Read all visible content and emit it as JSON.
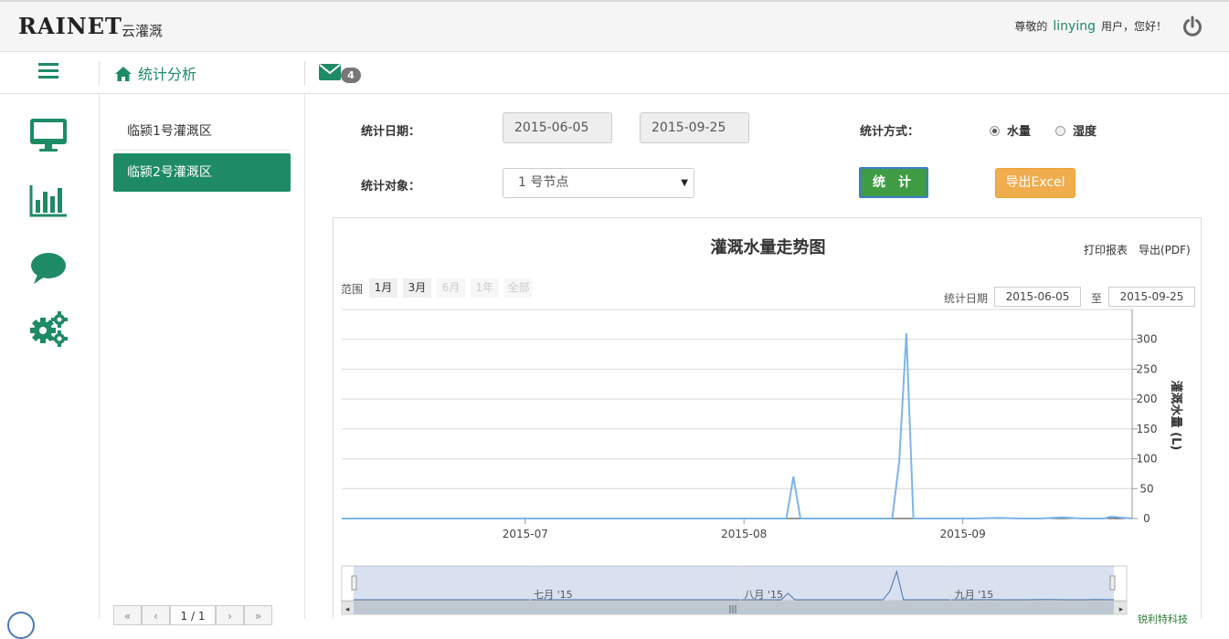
{
  "app": {
    "logo": "RAINET",
    "logo_sub": "云灌溉"
  },
  "header": {
    "greet_prefix": "尊敬的",
    "username": "linying",
    "greet_suffix": "用户，您好！",
    "power_icon": "power-icon"
  },
  "nav": {
    "breadcrumb": "统计分析",
    "mail_count": "4"
  },
  "sidebar": {
    "icons": [
      "monitor-icon",
      "bar-chart-icon",
      "chat-bubble-icon",
      "gears-icon"
    ]
  },
  "areas": {
    "items": [
      "临颍1号灌溉区",
      "临颍2号灌溉区"
    ],
    "active_index": 1,
    "pager": "1 / 1"
  },
  "form": {
    "date_label": "统计日期：",
    "start_date": "2015-06-05",
    "end_date": "2015-09-25",
    "mode_label": "统计方式：",
    "mode_water": "水量",
    "mode_humidity": "湿度",
    "mode_selected": "水量",
    "target_label": "统计对象：",
    "target_value": "1 号节点",
    "stat_button": "统计",
    "export_excel": "导出Excel"
  },
  "chart_panel": {
    "print": "打印报表",
    "export_pdf": "导出(PDF)",
    "range_label": "范围",
    "ranges": [
      "1月",
      "3月",
      "6月",
      "1年",
      "全部"
    ],
    "date_range_label": "统计日期",
    "date_from": "2015-06-05",
    "date_to_sep": "至",
    "date_to": "2015-09-25",
    "navigator_labels": [
      "七月 '15",
      "八月 '15",
      "九月 '15"
    ],
    "credit": "锐利特科技"
  },
  "chart_data": {
    "type": "line",
    "title": "灌溉水量走势图",
    "ylabel": "灌溉水量 (L)",
    "ylim": [
      0,
      350
    ],
    "yticks": [
      0,
      50,
      100,
      150,
      200,
      250,
      300
    ],
    "xlim": [
      "2015-06-05",
      "2015-09-25"
    ],
    "xticks": [
      "2015-07",
      "2015-08",
      "2015-09"
    ],
    "series": [
      {
        "name": "水量",
        "color": "#7cb5ec",
        "x": [
          "2015-06-05",
          "2015-08-07",
          "2015-08-08",
          "2015-08-09",
          "2015-08-21",
          "2015-08-22",
          "2015-08-23",
          "2015-08-24",
          "2015-08-25",
          "2015-09-03",
          "2015-09-06",
          "2015-09-09",
          "2015-09-12",
          "2015-09-15",
          "2015-09-18",
          "2015-09-21",
          "2015-09-22",
          "2015-09-25"
        ],
        "values": [
          0,
          0,
          70,
          0,
          0,
          0,
          95,
          310,
          0,
          0,
          1,
          0,
          0,
          2,
          0,
          0,
          3,
          0
        ]
      }
    ]
  }
}
